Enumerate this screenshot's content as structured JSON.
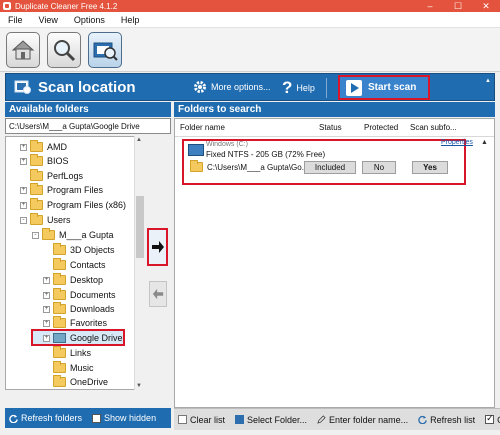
{
  "window": {
    "title": "Duplicate Cleaner Free 4.1.2"
  },
  "menu": [
    "File",
    "View",
    "Options",
    "Help"
  ],
  "header": {
    "title": "Scan location",
    "more_options": "More options...",
    "help": "Help",
    "start_scan": "Start scan"
  },
  "left_panel": {
    "heading": "Available folders",
    "path": "C:\\Users\\M___a Gupta\\Google Drive",
    "tree": [
      {
        "label": "AMD",
        "expander": "+"
      },
      {
        "label": "BIOS",
        "expander": "+"
      },
      {
        "label": "PerfLogs",
        "expander": ""
      },
      {
        "label": "Program Files",
        "expander": "+"
      },
      {
        "label": "Program Files (x86)",
        "expander": "+"
      },
      {
        "label": "Users",
        "expander": "-"
      },
      {
        "label": "M___a Gupta",
        "expander": "-"
      },
      {
        "label": "3D Objects",
        "expander": ""
      },
      {
        "label": "Contacts",
        "expander": ""
      },
      {
        "label": "Desktop",
        "expander": "+"
      },
      {
        "label": "Documents",
        "expander": "+"
      },
      {
        "label": "Downloads",
        "expander": "+"
      },
      {
        "label": "Favorites",
        "expander": "+"
      },
      {
        "label": "Google Drive",
        "expander": "+"
      },
      {
        "label": "Links",
        "expander": ""
      },
      {
        "label": "Music",
        "expander": ""
      },
      {
        "label": "OneDrive",
        "expander": ""
      }
    ],
    "refresh_folders": "Refresh folders",
    "show_hidden": "Show hidden"
  },
  "right_panel": {
    "heading": "Folders to search",
    "columns": [
      "Folder name",
      "Status",
      "Protected",
      "Scan subfo..."
    ],
    "drive_name": "Windows (C:)",
    "drive_info": "Fixed NTFS - 205 GB (72% Free)",
    "properties": "Properties",
    "folder_path": "C:\\Users\\M___a Gupta\\Go...",
    "status": "Included",
    "protected": "No",
    "scan_subfolders": "Yes",
    "bottom": {
      "clear_list": "Clear list",
      "select_folder": "Select Folder...",
      "enter_folder_name": "Enter folder name...",
      "refresh_list": "Refresh list",
      "truncated": "Gr"
    }
  }
}
